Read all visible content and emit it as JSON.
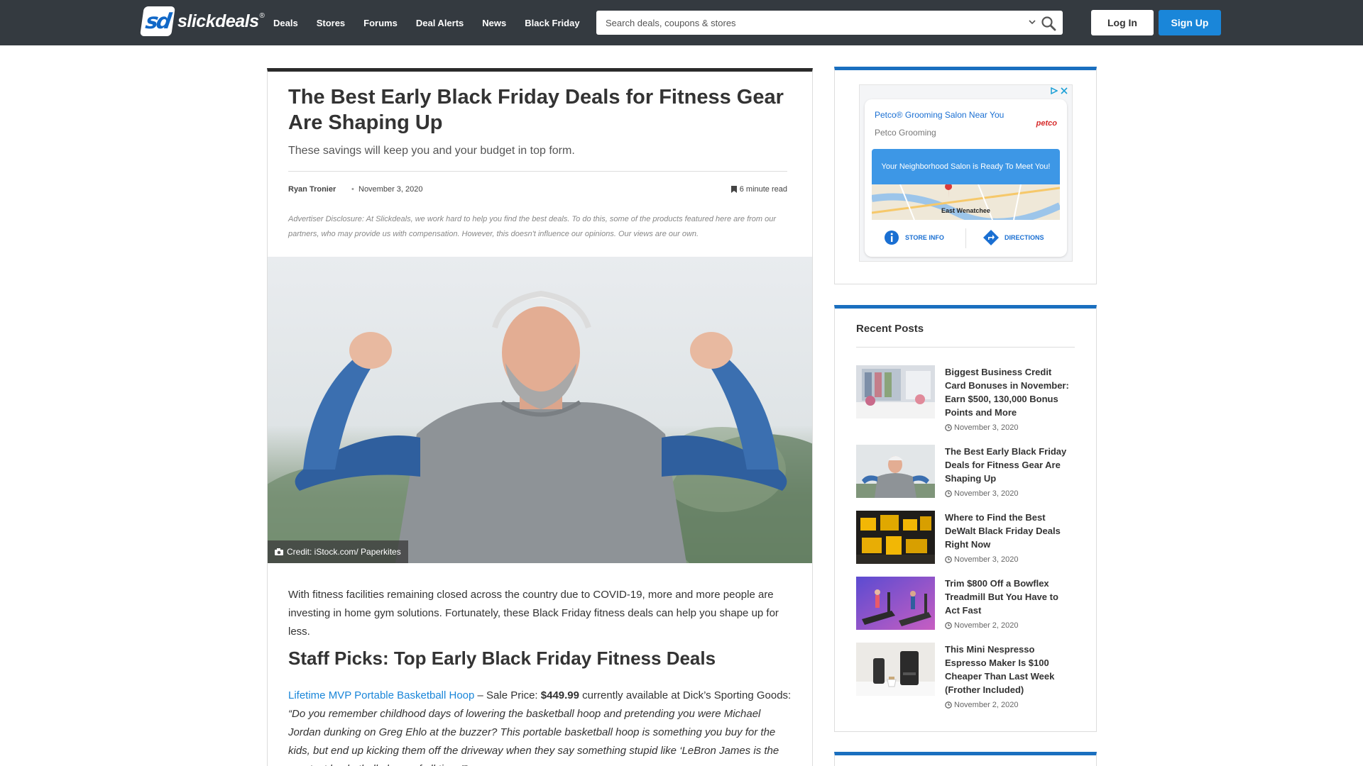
{
  "header": {
    "logo_text": "slickdeals",
    "logo_mark": "sd",
    "nav": [
      "Deals",
      "Stores",
      "Forums",
      "Deal Alerts",
      "News",
      "Black Friday"
    ],
    "search_placeholder": "Search deals, coupons & stores",
    "login_label": "Log In",
    "signup_label": "Sign Up"
  },
  "article": {
    "title": "The Best Early Black Friday Deals for Fitness Gear Are Shaping Up",
    "subtitle": "These savings will keep you and your budget in top form.",
    "author": "Ryan Tronier",
    "date": "November 3, 2020",
    "read_time": "6 minute read",
    "disclosure": "Advertiser Disclosure: At Slickdeals, we work hard to help you find the best deals. To do this, some of the products featured here are from our partners, who may provide us with compensation. However, this doesn't influence our opinions. Our views are our own.",
    "image_credit": "Credit: iStock.com/ Paperkites",
    "intro": "With fitness facilities remaining closed across the country due to COVID-19, more and more people are investing in home gym solutions. Fortunately, these Black Friday fitness deals can help you shape up for less.",
    "section_heading": "Staff Picks: Top Early Black Friday Fitness Deals",
    "pick": {
      "link_text": "Lifetime MVP Portable Basketball Hoop",
      "price_prefix": " – Sale Price: ",
      "price": "$449.99",
      "price_suffix": " currently available at Dick’s Sporting Goods: ",
      "quote": "“Do you remember childhood days of lowering the basketball hoop and pretending you were Michael Jordan dunking on Greg Ehlo at the buzzer? This portable basketball hoop is something you buy for the kids, but end up kicking them off the driveway when they say something stupid like ‘LeBron James is the greatest basketball player of all time.’”"
    }
  },
  "ad": {
    "headline": "Petco® Grooming Salon Near You",
    "advertiser": "Petco Grooming",
    "brand": "petco",
    "cta": "Your Neighborhood Salon is Ready To Meet You!",
    "map_label": "East Wenatchee",
    "store_info": "STORE INFO",
    "directions": "DIRECTIONS",
    "colors": {
      "accent": "#1a6fd2",
      "cta": "#3d97e6"
    }
  },
  "recent_posts": {
    "title": "Recent Posts",
    "items": [
      {
        "title": "Biggest Business Credit Card Bonuses in November: Earn $500, 130,000 Bonus Points and More",
        "date": "November 3, 2020",
        "thumb": "office-photo"
      },
      {
        "title": "The Best Early Black Friday Deals for Fitness Gear Are Shaping Up",
        "date": "November 3, 2020",
        "thumb": "flexing-man-photo"
      },
      {
        "title": "Where to Find the Best DeWalt Black Friday Deals Right Now",
        "date": "November 3, 2020",
        "thumb": "dewalt-tools-photo"
      },
      {
        "title": "Trim $800 Off a Bowflex Treadmill But You Have to Act Fast",
        "date": "November 2, 2020",
        "thumb": "treadmill-photo"
      },
      {
        "title": "This Mini Nespresso Espresso Maker Is $100 Cheaper Than Last Week (Frother Included)",
        "date": "November 2, 2020",
        "thumb": "espresso-photo"
      }
    ]
  },
  "colors": {
    "topbar": "#343a40",
    "brand_blue": "#1a86d9",
    "sidebar_accent": "#1a6fbf"
  }
}
